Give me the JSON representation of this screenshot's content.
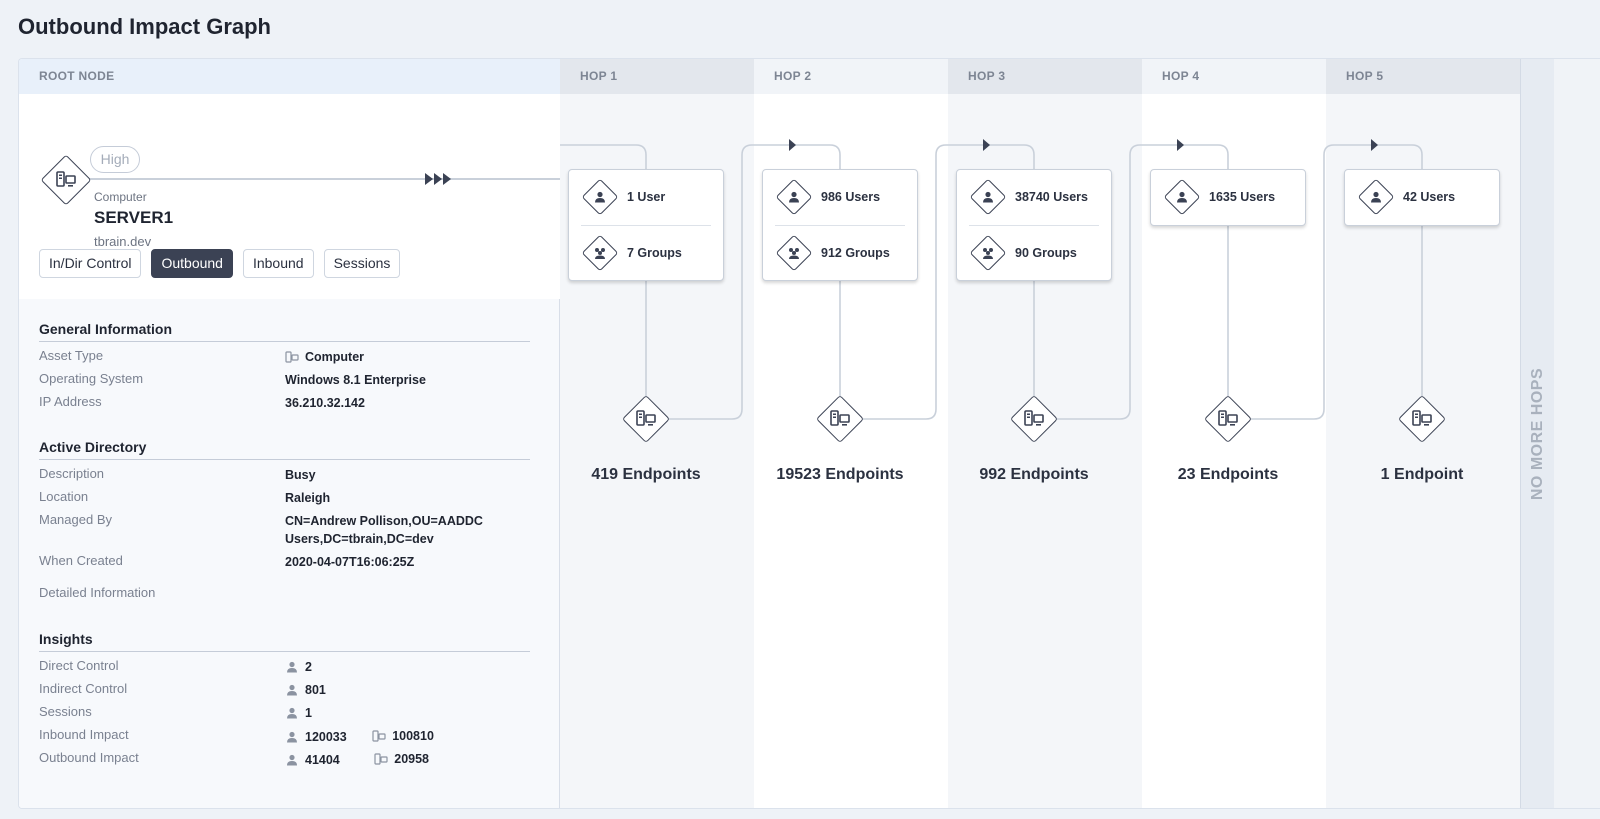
{
  "page_title": "Outbound Impact Graph",
  "root_column_header": "ROOT NODE",
  "root": {
    "risk": "High",
    "kind": "Computer",
    "name": "SERVER1",
    "domain": "tbrain.dev"
  },
  "tabs": [
    {
      "label": "In/Dir Control",
      "active": false
    },
    {
      "label": "Outbound",
      "active": true
    },
    {
      "label": "Inbound",
      "active": false
    },
    {
      "label": "Sessions",
      "active": false
    }
  ],
  "general": {
    "title": "General Information",
    "asset_type_label": "Asset Type",
    "asset_type_value": "Computer",
    "os_label": "Operating System",
    "os_value": "Windows 8.1 Enterprise",
    "ip_label": "IP Address",
    "ip_value": "36.210.32.142"
  },
  "ad": {
    "title": "Active Directory",
    "description_label": "Description",
    "description_value": "Busy",
    "location_label": "Location",
    "location_value": "Raleigh",
    "managed_by_label": "Managed By",
    "managed_by_value": "CN=Andrew Pollison,OU=AADDC Users,DC=tbrain,DC=dev",
    "when_created_label": "When Created",
    "when_created_value": "2020-04-07T16:06:25Z",
    "detailed_label": "Detailed Information"
  },
  "insights": {
    "title": "Insights",
    "direct_control_label": "Direct Control",
    "direct_control_value": "2",
    "indirect_control_label": "Indirect Control",
    "indirect_control_value": "801",
    "sessions_label": "Sessions",
    "sessions_value": "1",
    "inbound_label": "Inbound Impact",
    "inbound_users": "120033",
    "inbound_computers": "100810",
    "outbound_label": "Outbound Impact",
    "outbound_users": "41404",
    "outbound_computers": "20958"
  },
  "hops": [
    {
      "header": "HOP 1",
      "users": "1 User",
      "groups": "7 Groups",
      "endpoints": "419 Endpoints"
    },
    {
      "header": "HOP 2",
      "users": "986 Users",
      "groups": "912 Groups",
      "endpoints": "19523 Endpoints"
    },
    {
      "header": "HOP 3",
      "users": "38740 Users",
      "groups": "90 Groups",
      "endpoints": "992 Endpoints"
    },
    {
      "header": "HOP 4",
      "users": "1635 Users",
      "groups": null,
      "endpoints": "23 Endpoints"
    },
    {
      "header": "HOP 5",
      "users": "42 Users",
      "groups": null,
      "endpoints": "1 Endpoint"
    }
  ],
  "no_more_hops": "NO MORE HOPS",
  "colors": {
    "accent": "#3b4254",
    "wire": "#c9d0da",
    "active_tab": "#3b4254"
  },
  "icons": {
    "computer": "computer-icon",
    "user": "user-icon",
    "group": "group-icon"
  }
}
